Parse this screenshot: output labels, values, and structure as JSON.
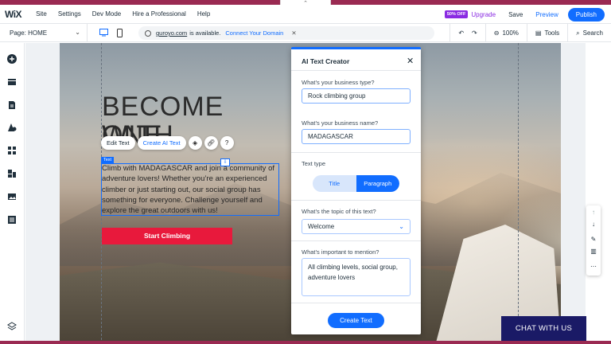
{
  "topbar": {
    "logo": "WiX",
    "menu": [
      "Site",
      "Settings",
      "Dev Mode",
      "Hire a Professional",
      "Help"
    ],
    "sale_badge": "50% OFF",
    "upgrade": "Upgrade",
    "save": "Save",
    "preview": "Preview",
    "publish": "Publish",
    "handle_icon": "chevron-up-icon"
  },
  "toolbar": {
    "page_label": "Page: HOME",
    "desktop_icon": "desktop-icon",
    "mobile_icon": "mobile-icon",
    "url_domain": "guroyo.com",
    "url_status": "is available.",
    "url_connect": "Connect Your Domain",
    "undo_icon": "undo-icon",
    "redo_icon": "redo-icon",
    "zoom": "100%",
    "tools": "Tools",
    "search": "Search"
  },
  "leftbar": {
    "icons": [
      "add-icon",
      "sections-icon",
      "pages-icon",
      "design-icon",
      "apps-icon",
      "business-icon",
      "media-icon",
      "cms-icon",
      "layers-icon"
    ]
  },
  "site": {
    "headline_line1": "BECOME ONE",
    "headline_line2": "WITH NATURE",
    "body": "Climb with MADAGASCAR and join a community of adventure lovers! Whether you’re an experienced climber or just starting out, our social group has something for everyone. Challenge yourself and explore the great outdoors with us!",
    "cta": "Start Climbing",
    "text_tag": "Text",
    "chat": "CHAT WITH US"
  },
  "floatbar": {
    "edit_text": "Edit Text",
    "create_ai_text": "Create AI Text",
    "icons": [
      "animation-icon",
      "link-icon",
      "help-icon"
    ]
  },
  "panel": {
    "title": "AI Text Creator",
    "business_type_label": "What’s your business type?",
    "business_type_value": "Rock climbing group",
    "business_name_label": "What’s your business name?",
    "business_name_value": "MADAGASCAR",
    "text_type_label": "Text type",
    "text_type_options": [
      "Title",
      "Paragraph"
    ],
    "text_type_selected": "Paragraph",
    "topic_label": "What’s the topic of this text?",
    "topic_value": "Welcome",
    "mention_label": "What’s important to mention?",
    "mention_value": "All climbing levels, social group, adventure lovers",
    "create_button": "Create Text"
  },
  "rightbar": {
    "icons": [
      "arrow-up-icon",
      "arrow-down-icon",
      "pen-icon",
      "layout-icon",
      "more-icon"
    ]
  },
  "colors": {
    "accent": "#116dff",
    "brand_stripe": "#9a2a52",
    "cta": "#e8193c",
    "chat": "#1a1a66",
    "upgrade": "#8a2be2"
  }
}
